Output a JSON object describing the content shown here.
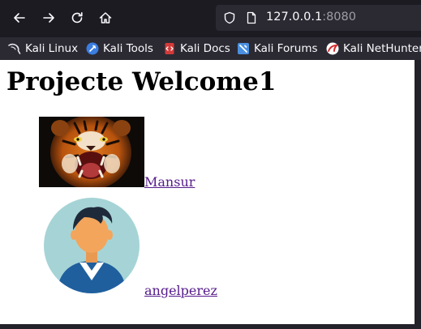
{
  "browser": {
    "url_host": "127.0.0.1",
    "url_port": ":8080",
    "bookmarks": [
      {
        "label": "Kali Linux",
        "icon": "kali-dragon-icon"
      },
      {
        "label": "Kali Tools",
        "icon": "kali-tools-icon"
      },
      {
        "label": "Kali Docs",
        "icon": "kali-docs-icon"
      },
      {
        "label": "Kali Forums",
        "icon": "kali-forums-icon"
      },
      {
        "label": "Kali NetHunter",
        "icon": "kali-nethunter-icon"
      }
    ]
  },
  "page": {
    "title": "Projecte Welcome1",
    "users": [
      {
        "name": "Mansur",
        "image": "tiger-photo"
      },
      {
        "name": "angelperez",
        "image": "avatar-illustration"
      }
    ]
  }
}
